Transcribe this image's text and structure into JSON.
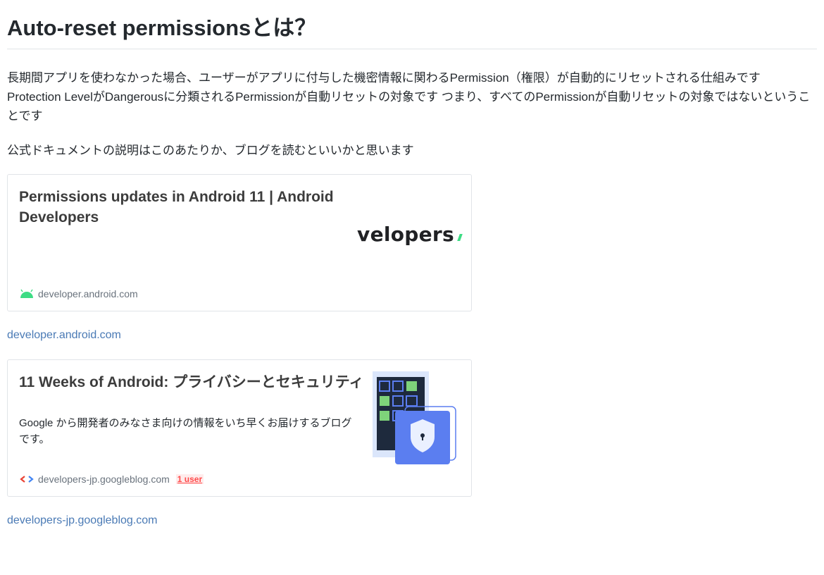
{
  "heading": "Auto-reset permissionsとは？",
  "paragraphs": [
    "長期間アプリを使わなかった場合、ユーザーがアプリに付与した機密情報に関わるPermission（権限）が自動的にリセットされる仕組みです Protection LevelがDangerousに分類されるPermissionが自動リセットの対象です つまり、すべてのPermissionが自動リセットの対象ではないということです",
    "公式ドキュメントの説明はこのあたりか、ブログを読むといいかと思います"
  ],
  "cards": [
    {
      "title": "Permissions updates in Android 11  |  Android Developers",
      "description": "",
      "domain": "developer.android.com",
      "favicon": "android-icon",
      "thumbnail_text": "velopers",
      "users": ""
    },
    {
      "title": "11 Weeks of Android: プライバシーとセキュリティ",
      "description": "Google から開発者のみなさま向けの情報をいち早くお届けするブログです。",
      "domain": "developers-jp.googleblog.com",
      "favicon": "code-brackets-icon",
      "thumbnail_text": "",
      "users": "1 user"
    }
  ],
  "links": [
    "developer.android.com",
    "developers-jp.googleblog.com"
  ],
  "colors": {
    "link": "#4a7ab5",
    "android_green": "#3ddc84",
    "users_badge": "#ff4b4b",
    "shield_blue": "#5b7ef0"
  }
}
